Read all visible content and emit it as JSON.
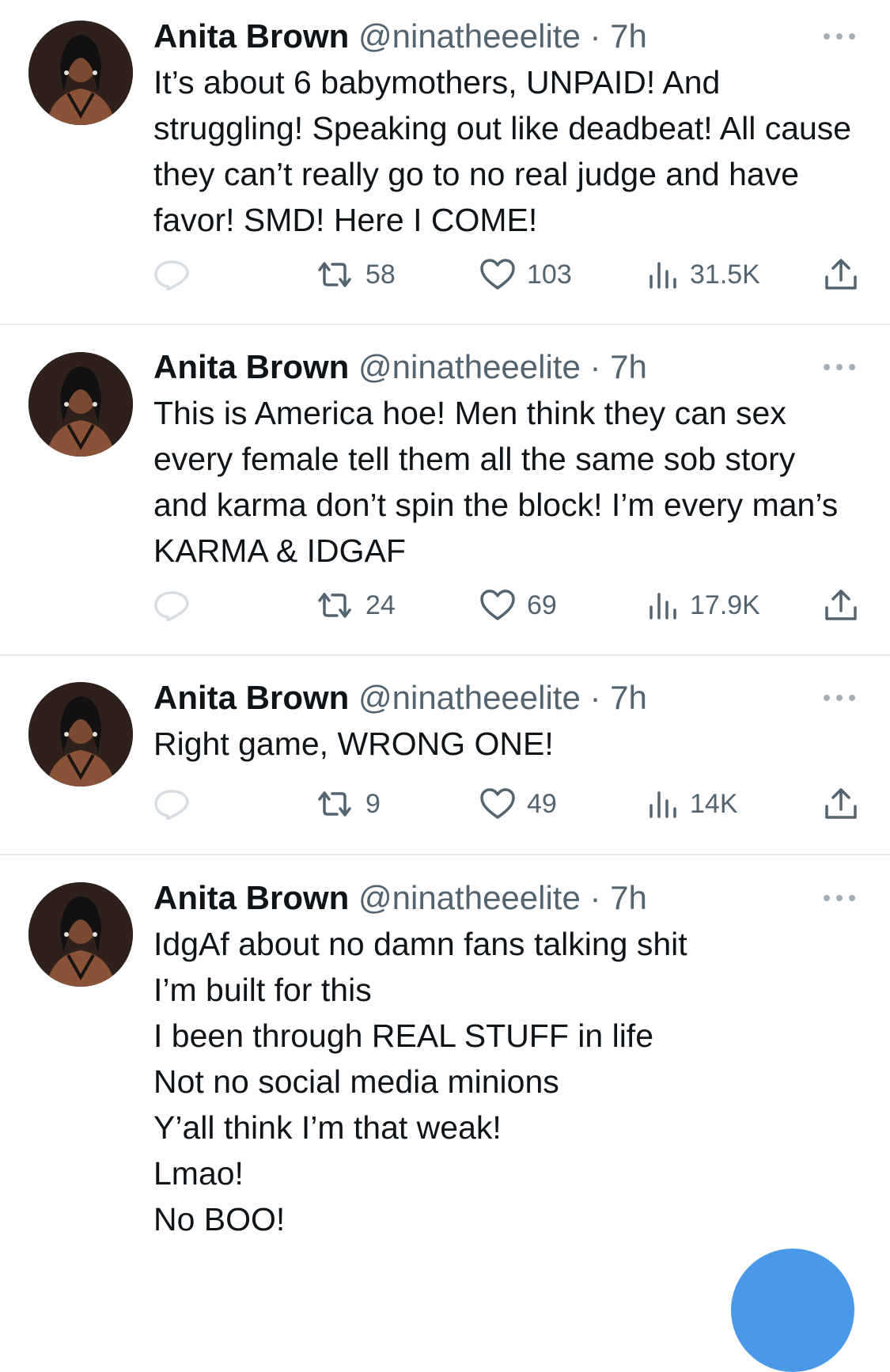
{
  "tweets": [
    {
      "name": "Anita Brown",
      "handle": "@ninatheeelite",
      "time": "· 7h",
      "text": "It’s about 6 babymothers, UNPAID! And struggling! Speaking out like deadbeat! All cause they can’t really go to no real judge and have favor! SMD! Here I COME!",
      "retweets": "58",
      "likes": "103",
      "views": "31.5K"
    },
    {
      "name": "Anita Brown",
      "handle": "@ninatheeelite",
      "time": "· 7h",
      "text": "This is America hoe! Men think they can sex every female tell them all the same sob story and karma don’t spin the block! I’m every man’s KARMA & IDGAF",
      "retweets": "24",
      "likes": "69",
      "views": "17.9K"
    },
    {
      "name": "Anita Brown",
      "handle": "@ninatheeelite",
      "time": "· 7h",
      "text": "Right game, WRONG ONE!",
      "retweets": "9",
      "likes": "49",
      "views": "14K"
    },
    {
      "name": "Anita Brown",
      "handle": "@ninatheeelite",
      "time": "· 7h",
      "text": "IdgAf about no damn fans talking shit\nI’m built for this\nI been through REAL STUFF in life\nNot no social media minions\nY’all think I’m that weak!\nLmao!\nNo BOO!"
    }
  ],
  "icons": {
    "reply": "reply-icon",
    "retweet": "retweet-icon",
    "like": "heart-icon",
    "views": "views-icon",
    "share": "share-icon",
    "more": "more-icon",
    "compose": "compose-button"
  },
  "colors": {
    "text": "#0f1419",
    "secondary": "#536471",
    "divider": "#e6e9ec",
    "accent": "#4a99e9"
  }
}
